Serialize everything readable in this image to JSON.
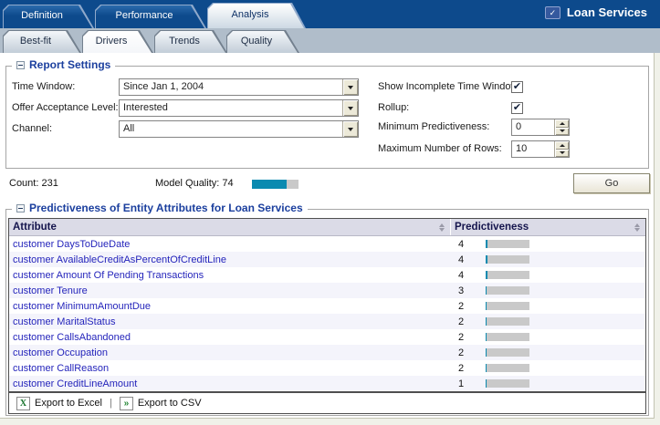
{
  "brand": {
    "logo_label": "Loan Services",
    "icon_glyph": "✓"
  },
  "top_tabs": [
    {
      "label": "Definition",
      "active": false
    },
    {
      "label": "Performance",
      "active": false
    },
    {
      "label": "Analysis",
      "active": true
    }
  ],
  "sub_tabs": [
    {
      "label": "Best-fit",
      "active": false
    },
    {
      "label": "Drivers",
      "active": true
    },
    {
      "label": "Trends",
      "active": false
    },
    {
      "label": "Quality",
      "active": false
    }
  ],
  "report_settings": {
    "legend": "Report Settings",
    "fields_left": [
      {
        "label": "Time Window:",
        "value": "Since Jan 1, 2004",
        "type": "dropdown"
      },
      {
        "label": "Offer Acceptance Level:",
        "value": "Interested",
        "type": "dropdown"
      },
      {
        "label": "Channel:",
        "value": "All",
        "type": "dropdown"
      }
    ],
    "fields_right": [
      {
        "label": "Show Incomplete Time Window:",
        "type": "checkbox",
        "checked": true
      },
      {
        "label": "Rollup:",
        "type": "checkbox",
        "checked": true
      },
      {
        "label": "Minimum Predictiveness:",
        "type": "spinner",
        "value": "0"
      },
      {
        "label": "Maximum Number of Rows:",
        "type": "spinner",
        "value": "10"
      }
    ]
  },
  "status_row": {
    "count_label": "Count: 231",
    "model_quality_label": "Model Quality: 74",
    "model_quality_pct": 74,
    "go_label": "Go"
  },
  "table_section": {
    "legend": "Predictiveness of Entity Attributes for Loan Services",
    "columns": [
      "Attribute",
      "Predictiveness"
    ],
    "bar_scale_max": 100,
    "rows": [
      {
        "attribute": "customer DaysToDueDate",
        "predictiveness": 4
      },
      {
        "attribute": "customer AvailableCreditAsPercentOfCreditLine",
        "predictiveness": 4
      },
      {
        "attribute": "customer Amount Of Pending Transactions",
        "predictiveness": 4
      },
      {
        "attribute": "customer Tenure",
        "predictiveness": 3
      },
      {
        "attribute": "customer MinimumAmountDue",
        "predictiveness": 2
      },
      {
        "attribute": "customer MaritalStatus",
        "predictiveness": 2
      },
      {
        "attribute": "customer CallsAbandoned",
        "predictiveness": 2
      },
      {
        "attribute": "customer Occupation",
        "predictiveness": 2
      },
      {
        "attribute": "customer CallReason",
        "predictiveness": 2
      },
      {
        "attribute": "customer CreditLineAmount",
        "predictiveness": 1
      }
    ]
  },
  "footer": {
    "export_excel_label": "Export to Excel",
    "separator": "|",
    "export_csv_label": "Export to CSV",
    "excel_icon_glyph": "X",
    "csv_icon_glyph": "»"
  },
  "icons": {
    "checkbox_check": "✔"
  },
  "colors": {
    "banner_blue": "#0d4a8c",
    "accent_teal": "#0a8ab0",
    "link_blue": "#2424bb",
    "legend_navy": "#1b3f9e",
    "table_header_bg": "#dbdbe7",
    "subtab_bar": "#b0bdca",
    "row_alt": "#f4f4fb",
    "bar_track_gray": "#c9c9c9"
  }
}
